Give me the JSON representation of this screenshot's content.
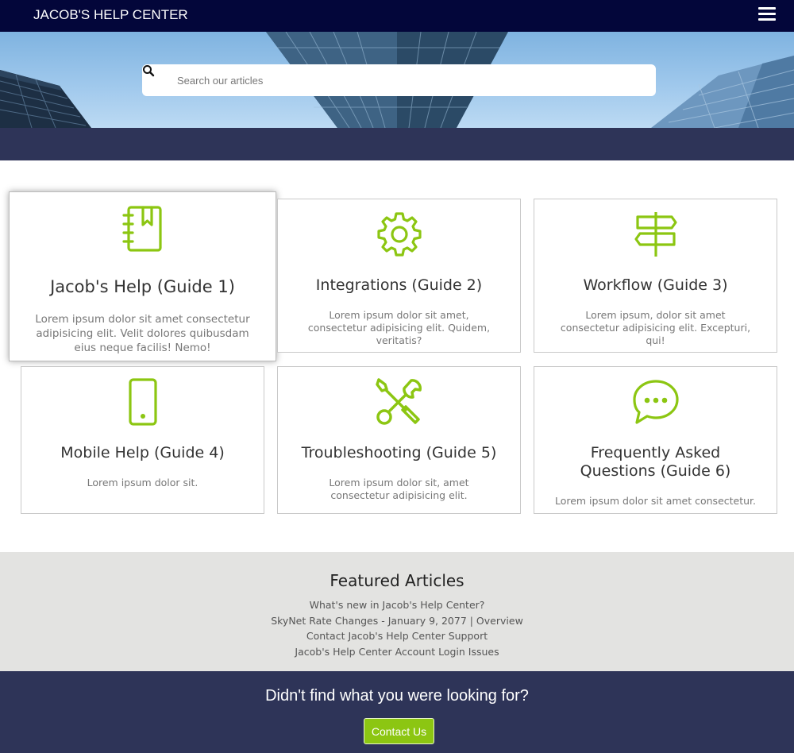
{
  "header": {
    "brand": "JACOB'S HELP CENTER",
    "menu_icon": "hamburger-menu-icon"
  },
  "search": {
    "placeholder": "Search our articles",
    "icon": "search-icon"
  },
  "colors": {
    "navbar": "#03063a",
    "band": "#2e3458",
    "accent": "#8cc612",
    "featured_bg": "#e3e3e1"
  },
  "guides": [
    {
      "icon": "notebook-bookmark-icon",
      "title": "Jacob's Help (Guide 1)",
      "description": "Lorem ipsum dolor sit amet consectetur adipisicing elit. Velit dolores quibusdam eius neque facilis! Nemo!"
    },
    {
      "icon": "gear-icon",
      "title": "Integrations (Guide 2)",
      "description": "Lorem ipsum dolor sit amet, consectetur adipisicing elit. Quidem, veritatis?"
    },
    {
      "icon": "signpost-icon",
      "title": "Workflow (Guide 3)",
      "description": "Lorem ipsum, dolor sit amet consectetur adipisicing elit. Excepturi, qui!"
    },
    {
      "icon": "mobile-phone-icon",
      "title": "Mobile Help (Guide 4)",
      "description": "Lorem ipsum dolor sit."
    },
    {
      "icon": "wrench-screwdriver-icon",
      "title": "Troubleshooting (Guide 5)",
      "description": "Lorem ipsum dolor sit, amet consectetur adipisicing elit."
    },
    {
      "icon": "chat-bubble-icon",
      "title": "Frequently Asked Questions (Guide 6)",
      "description": "Lorem ipsum dolor sit amet consectetur."
    }
  ],
  "featured": {
    "heading": "Featured Articles",
    "articles": [
      "What's new in Jacob's Help Center?",
      "SkyNet Rate Changes - January 9, 2077 | Overview",
      "Contact Jacob's Help Center Support",
      "Jacob's Help Center Account Login Issues"
    ]
  },
  "footer": {
    "question": "Didn't find what you were looking for?",
    "contact_label": "Contact Us"
  }
}
